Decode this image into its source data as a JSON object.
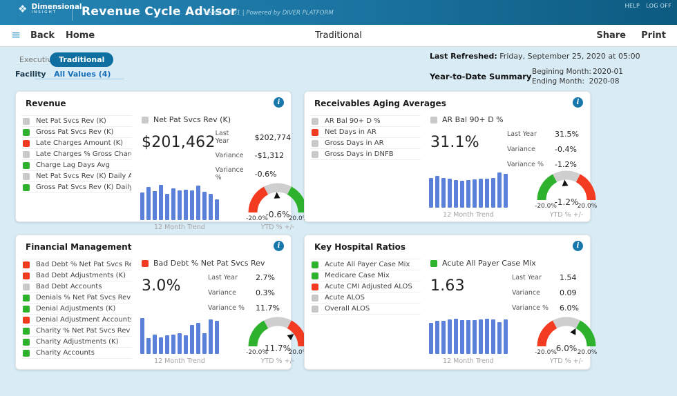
{
  "header": {
    "brand_line1": "Dimensional",
    "brand_line2": "INSIGHT",
    "brand_icon": "❖",
    "title": "Revenue Cycle Advisor",
    "version": "Version 3.01  |  Powered by DIVER PLATFORM",
    "help": "HELP",
    "log_off": "LOG OFF"
  },
  "nav": {
    "menu_icon": "≡",
    "back": "Back",
    "home": "Home",
    "center_title": "Traditional",
    "share": "Share",
    "print": "Print"
  },
  "filters": {
    "tabs": [
      {
        "label": "Executive",
        "active": false
      },
      {
        "label": "Traditional",
        "active": true
      }
    ],
    "facility_label": "Facility",
    "facility_value": "All Values (4)"
  },
  "refresh": {
    "label": "Last Refreshed:",
    "value": "Friday, September 25, 2020 at 05:00"
  },
  "ytd": {
    "label": "Year-to-Date Summary",
    "begin_label": "Begining Month:",
    "begin_value": "2020-01",
    "end_label": "Ending Month:",
    "end_value": "2020-08"
  },
  "colors": {
    "bar": "#5b80d9",
    "green": "#2eb22e",
    "red": "#f23b20",
    "gray": "#c9c9c9",
    "gauge_gray": "#cfcfcf"
  },
  "panels": [
    {
      "key": "revenue",
      "title": "Revenue",
      "info_icon": "i",
      "metrics": [
        {
          "color": "gray",
          "label": "Net Pat Svcs Rev (K)"
        },
        {
          "color": "green",
          "label": "Gross Pat Svcs Rev (K)"
        },
        {
          "color": "red",
          "label": "Late Charges Amount (K)"
        },
        {
          "color": "gray",
          "label": "Late Charges % Gross Charges"
        },
        {
          "color": "green",
          "label": "Charge Lag Days Avg"
        },
        {
          "color": "gray",
          "label": "Net Pat Svcs Rev (K) Daily Avg"
        },
        {
          "color": "green",
          "label": "Gross Pat Svcs Rev (K) Daily Avg"
        }
      ],
      "selected": {
        "color": "gray",
        "label": "Net Pat Svcs Rev (K)"
      },
      "value": "$201,462",
      "stats": [
        {
          "label": "Last Year",
          "value": "$202,774"
        },
        {
          "label": "Variance",
          "value": "-$1,312"
        },
        {
          "label": "Variance %",
          "value": "-0.6%"
        }
      ],
      "trend": {
        "caption": "12 Month Trend",
        "values": [
          0.74,
          0.88,
          0.78,
          0.95,
          0.7,
          0.85,
          0.8,
          0.82,
          0.8,
          0.93,
          0.76,
          0.7,
          0.56
        ]
      },
      "gauge": {
        "value": "-0.6%",
        "numeric": -0.6,
        "min_label": "-20.0%",
        "max_label": "20.0%",
        "caption": "YTD % +/-",
        "direction": "normal"
      }
    },
    {
      "key": "receivables",
      "title": "Receivables Aging Averages",
      "info_icon": "i",
      "metrics": [
        {
          "color": "gray",
          "label": "AR Bal 90+ D %"
        },
        {
          "color": "red",
          "label": "Net Days in AR"
        },
        {
          "color": "gray",
          "label": "Gross Days in AR"
        },
        {
          "color": "gray",
          "label": "Gross Days in DNFB"
        }
      ],
      "selected": {
        "color": "gray",
        "label": "AR Bal 90+ D %"
      },
      "value": "31.1%",
      "stats": [
        {
          "label": "Last Year",
          "value": "31.5%"
        },
        {
          "label": "Variance",
          "value": "-0.4%"
        },
        {
          "label": "Variance %",
          "value": "-1.2%"
        }
      ],
      "trend": {
        "caption": "12 Month Trend",
        "values": [
          0.8,
          0.85,
          0.8,
          0.78,
          0.74,
          0.72,
          0.74,
          0.76,
          0.78,
          0.78,
          0.8,
          0.95,
          0.9
        ]
      },
      "gauge": {
        "value": "-1.2%",
        "numeric": -1.2,
        "min_label": "-20.0%",
        "max_label": "20.0%",
        "caption": "YTD % +/-",
        "direction": "inverted"
      }
    },
    {
      "key": "financial",
      "title": "Financial Management",
      "info_icon": "i",
      "metrics": [
        {
          "color": "red",
          "label": "Bad Debt % Net Pat Svcs Rev"
        },
        {
          "color": "red",
          "label": "Bad Debt Adjustments (K)"
        },
        {
          "color": "gray",
          "label": "Bad Debt Accounts"
        },
        {
          "color": "green",
          "label": "Denials % Net Pat Svcs Rev"
        },
        {
          "color": "green",
          "label": "Denial Adjustments (K)"
        },
        {
          "color": "red",
          "label": "Denial Adjustment Accounts"
        },
        {
          "color": "green",
          "label": "Charity % Net Pat Svcs Rev"
        },
        {
          "color": "green",
          "label": "Charity Adjustments (K)"
        },
        {
          "color": "green",
          "label": "Charity Accounts"
        }
      ],
      "selected": {
        "color": "red",
        "label": "Bad Debt % Net Pat Svcs Rev"
      },
      "value": "3.0%",
      "stats": [
        {
          "label": "Last Year",
          "value": "2.7%"
        },
        {
          "label": "Variance",
          "value": "0.3%"
        },
        {
          "label": "Variance %",
          "value": "11.7%"
        }
      ],
      "trend": {
        "caption": "12 Month Trend",
        "values": [
          0.97,
          0.42,
          0.52,
          0.45,
          0.5,
          0.52,
          0.55,
          0.5,
          0.78,
          0.83,
          0.55,
          0.92,
          0.88
        ]
      },
      "gauge": {
        "value": "11.7%",
        "numeric": 11.7,
        "min_label": "-20.0%",
        "max_label": "20.0%",
        "caption": "YTD % +/-",
        "direction": "inverted"
      }
    },
    {
      "key": "ratios",
      "title": "Key Hospital Ratios",
      "info_icon": "i",
      "metrics": [
        {
          "color": "green",
          "label": "Acute All Payer Case Mix"
        },
        {
          "color": "green",
          "label": "Medicare Case Mix"
        },
        {
          "color": "red",
          "label": "Acute CMI Adjusted ALOS"
        },
        {
          "color": "gray",
          "label": "Acute ALOS"
        },
        {
          "color": "gray",
          "label": "Overall ALOS"
        }
      ],
      "selected": {
        "color": "green",
        "label": "Acute All Payer Case Mix"
      },
      "value": "1.63",
      "stats": [
        {
          "label": "Last Year",
          "value": "1.54"
        },
        {
          "label": "Variance",
          "value": "0.09"
        },
        {
          "label": "Variance %",
          "value": "6.0%"
        }
      ],
      "trend": {
        "caption": "12 Month Trend",
        "values": [
          0.84,
          0.88,
          0.88,
          0.92,
          0.94,
          0.9,
          0.9,
          0.9,
          0.92,
          0.95,
          0.92,
          0.86,
          0.92
        ]
      },
      "gauge": {
        "value": "6.0%",
        "numeric": 6.0,
        "min_label": "-20.0%",
        "max_label": "20.0%",
        "caption": "YTD % +/-",
        "direction": "normal"
      }
    }
  ]
}
